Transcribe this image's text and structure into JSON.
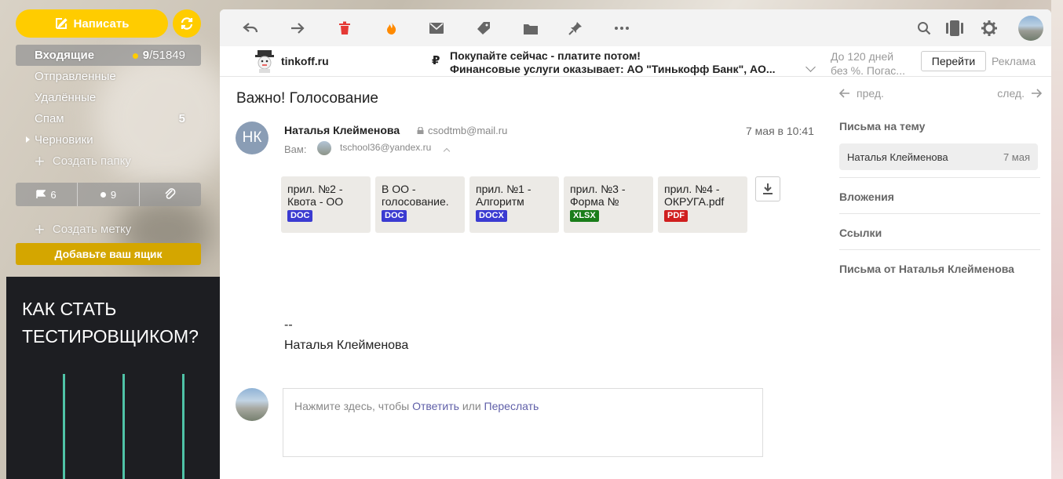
{
  "sidebar": {
    "compose_label": "Написать",
    "folders": [
      {
        "label": "Входящие",
        "unread": "9",
        "total": "/51849"
      },
      {
        "label": "Отправленные",
        "count": ""
      },
      {
        "label": "Удалённые",
        "count": ""
      },
      {
        "label": "Спам",
        "count": "5"
      },
      {
        "label": "Черновики",
        "count": ""
      }
    ],
    "create_folder": "Создать папку",
    "filters": {
      "flagged": "6",
      "unread": "9"
    },
    "create_label": "Создать метку",
    "add_mailbox": "Добавьте ваш ящик",
    "ad_title_1": "КАК СТАТЬ",
    "ad_title_2": "ТЕСТИРОВЩИКОМ?"
  },
  "adbar": {
    "domain": "tinkoff.ru",
    "currency": "₽",
    "headline_1": "Покупайте сейчас - платите потом!",
    "headline_2": "Финансовые услуги оказывает: АО \"Тинькофф Банк\", АО...",
    "side_1": "До 120 дней",
    "side_2": "без %. Погас...",
    "go_label": "Перейти",
    "ad_label": "Реклама"
  },
  "message": {
    "subject": "Важно! Голосование",
    "sender_initials": "НК",
    "sender_name": "Наталья Клейменова",
    "sender_email": "csodtmb@mail.ru",
    "to_label": "Вам:",
    "to_email": "tschool36@yandex.ru",
    "date": "7 мая в 10:41",
    "attachments": [
      {
        "name": "прил. №2 -\nКвота - ОО",
        "ext": "DOC",
        "color": "#3b3bd1"
      },
      {
        "name": "В ОО -\nголосование.",
        "ext": "DOC",
        "color": "#3b3bd1"
      },
      {
        "name": "прил. №1 -\nАлгоритм",
        "ext": "DOCX",
        "color": "#3b3bd1"
      },
      {
        "name": "прил. №3 -\nФорма №",
        "ext": "XLSX",
        "color": "#1a7d1a"
      },
      {
        "name": "прил. №4 -\nОКРУГА.pdf",
        "ext": "PDF",
        "color": "#d01f1f"
      }
    ],
    "signature_dash": "--",
    "signature_name": "Наталья Клейменова"
  },
  "reply": {
    "prompt": "Нажмите здесь, чтобы",
    "reply_link": "Ответить",
    "or": "или",
    "forward_link": "Переслать"
  },
  "right_panel": {
    "prev": "пред.",
    "next": "след.",
    "thread_header": "Письма на тему",
    "thread_item_name": "Наталья Клейменова",
    "thread_item_date": "7 мая",
    "attachments": "Вложения",
    "links": "Ссылки",
    "from_sender": "Письма от Наталья Клейменова"
  },
  "colors": {
    "accent": "#ffcc00",
    "add_mailbox_bg": "#d4a600",
    "avatar_bg": "#8a9db5",
    "link": "#5f5fa8",
    "delete_icon": "#e53935",
    "fire_icon": "#ff8a00"
  }
}
